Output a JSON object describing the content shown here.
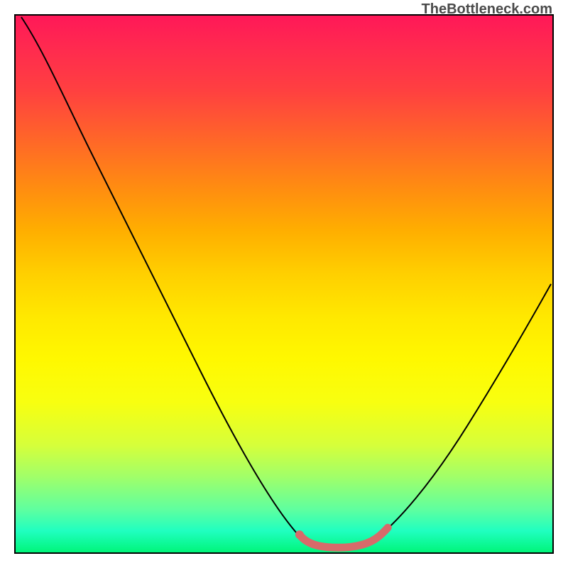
{
  "watermark": "TheBottleneck.com",
  "chart_data": {
    "type": "line",
    "title": "",
    "xlabel": "",
    "ylabel": "",
    "xlim": [
      0,
      100
    ],
    "ylim": [
      0,
      100
    ],
    "series": [
      {
        "name": "bottleneck-curve",
        "x": [
          0,
          5,
          10,
          15,
          20,
          25,
          30,
          35,
          40,
          45,
          50,
          53,
          56,
          60,
          64,
          67,
          70,
          75,
          80,
          85,
          90,
          95,
          100
        ],
        "values": [
          100,
          94,
          86,
          76,
          66,
          56,
          46,
          36,
          26,
          16,
          8,
          3,
          1,
          0,
          0,
          1,
          3,
          8,
          15,
          23,
          32,
          41,
          50
        ]
      },
      {
        "name": "highlight-segment",
        "x": [
          53,
          56,
          60,
          64,
          67
        ],
        "values": [
          3,
          1,
          0,
          0,
          1
        ]
      }
    ],
    "colors": {
      "curve": "#000000",
      "highlight": "#d86a6a"
    }
  }
}
